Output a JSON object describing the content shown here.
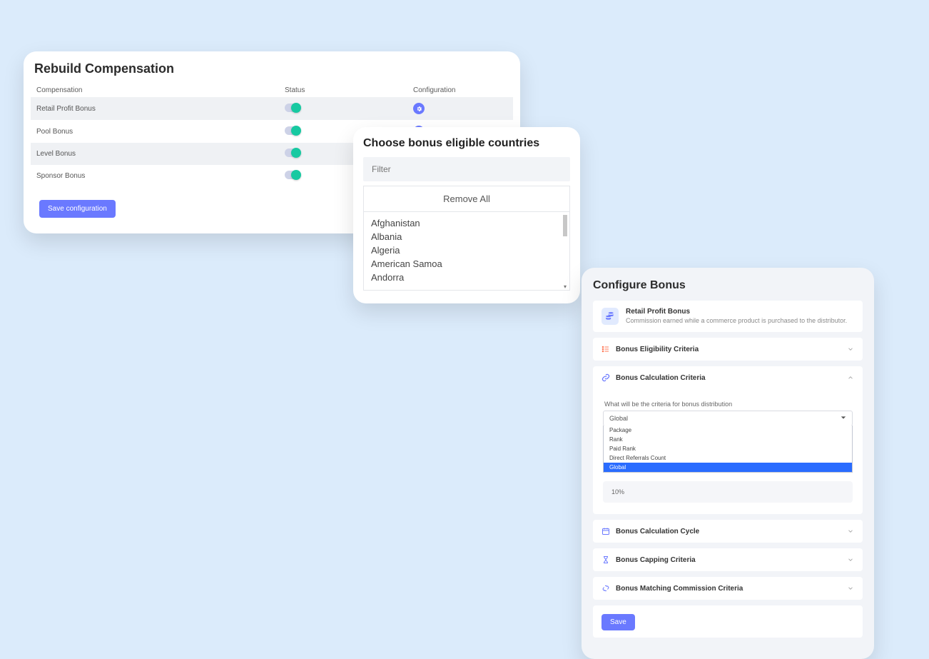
{
  "rebuild": {
    "title": "Rebuild Compensation",
    "columns": {
      "compensation": "Compensation",
      "status": "Status",
      "configuration": "Configuration"
    },
    "rows": [
      {
        "name": "Retail Profit Bonus"
      },
      {
        "name": "Pool Bonus"
      },
      {
        "name": "Level Bonus"
      },
      {
        "name": "Sponsor Bonus"
      }
    ],
    "save_label": "Save configuration"
  },
  "countries": {
    "title": "Choose bonus eligible countries",
    "filter_placeholder": "Filter",
    "remove_all": "Remove All",
    "list": [
      "Afghanistan",
      "Albania",
      "Algeria",
      "American Samoa",
      "Andorra"
    ]
  },
  "configure": {
    "title": "Configure Bonus",
    "info": {
      "name": "Retail Profit Bonus",
      "desc": "Commission earned while a commerce product is purchased to the distributor."
    },
    "sections": {
      "eligibility": "Bonus Eligibility Criteria",
      "calculation": "Bonus Calculation Criteria",
      "cycle": "Bonus Calculation Cycle",
      "capping": "Bonus Capping Criteria",
      "matching": "Bonus Matching Commission Criteria"
    },
    "calculation": {
      "criteria_label": "What will be the criteria for bonus distribution",
      "selected": "Global",
      "options": [
        "Package",
        "Rank",
        "Paid Rank",
        "Direct Referrals Count",
        "Global"
      ],
      "value": "10%"
    },
    "save_label": "Save"
  },
  "colors": {
    "accent": "#6a79ff",
    "toggle_on": "#17c9a1"
  }
}
